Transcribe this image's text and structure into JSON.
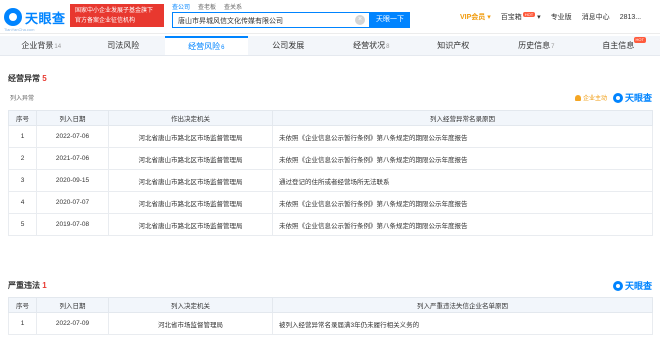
{
  "header": {
    "logo_text": "天眼查",
    "logo_sub": "TianYanCha.com",
    "banner_line1": "国家中小企业发展子基金旗下",
    "banner_line2": "官方备案企业征信机构",
    "search_tabs": [
      "查公司",
      "查老板",
      "查关系"
    ],
    "search_value": "唐山市昇城风信文化传媒有限公司",
    "search_clear": "×",
    "search_button": "天眼一下",
    "nav": [
      "VIP会员",
      "百宝箱",
      "专业版",
      "消息中心",
      "2813..."
    ],
    "hot_badge": "HOT"
  },
  "tabs": [
    {
      "label": "企业背景",
      "count": "14"
    },
    {
      "label": "司法风险",
      "count": ""
    },
    {
      "label": "经营风险",
      "count": "6"
    },
    {
      "label": "公司发展",
      "count": ""
    },
    {
      "label": "经营状况",
      "count": "8"
    },
    {
      "label": "知识产权",
      "count": ""
    },
    {
      "label": "历史信息",
      "count": "7"
    },
    {
      "label": "自主信息",
      "count": ""
    }
  ],
  "abnormal": {
    "title": "经营异常",
    "count": "5",
    "list_label": "列入异常",
    "follow_label": "企业主动",
    "watermark": "天眼查",
    "columns": [
      "序号",
      "列入日期",
      "作出决定机关",
      "列入经营异常名录原因"
    ],
    "rows": [
      [
        "1",
        "2022-07-06",
        "河北省唐山市路北区市场监督管理局",
        "未依照《企业信息公示暂行条例》第八条规定的期限公示年度报告"
      ],
      [
        "2",
        "2021-07-06",
        "河北省唐山市路北区市场监督管理局",
        "未依照《企业信息公示暂行条例》第八条规定的期限公示年度报告"
      ],
      [
        "3",
        "2020-09-15",
        "河北省唐山市路北区市场监督管理局",
        "通过登记的住所或者经营场所无法联系"
      ],
      [
        "4",
        "2020-07-07",
        "河北省唐山市路北区市场监督管理局",
        "未依照《企业信息公示暂行条例》第八条规定的期限公示年度报告"
      ],
      [
        "5",
        "2019-07-08",
        "河北省唐山市路北区市场监督管理局",
        "未依照《企业信息公示暂行条例》第八条规定的期限公示年度报告"
      ]
    ]
  },
  "violation": {
    "title": "严重违法",
    "count": "1",
    "watermark": "天眼查",
    "columns": [
      "序号",
      "列入日期",
      "列入决定机关",
      "列入严重违法失信企业名单原因"
    ],
    "rows": [
      [
        "1",
        "2022-07-09",
        "河北省市场监督管理局",
        "被列入经营异常名录届满3年仍未履行相关义务的"
      ]
    ]
  },
  "colors": {
    "brand": "#0084ff",
    "alert": "#e8382f",
    "vip": "#f09a0b"
  }
}
